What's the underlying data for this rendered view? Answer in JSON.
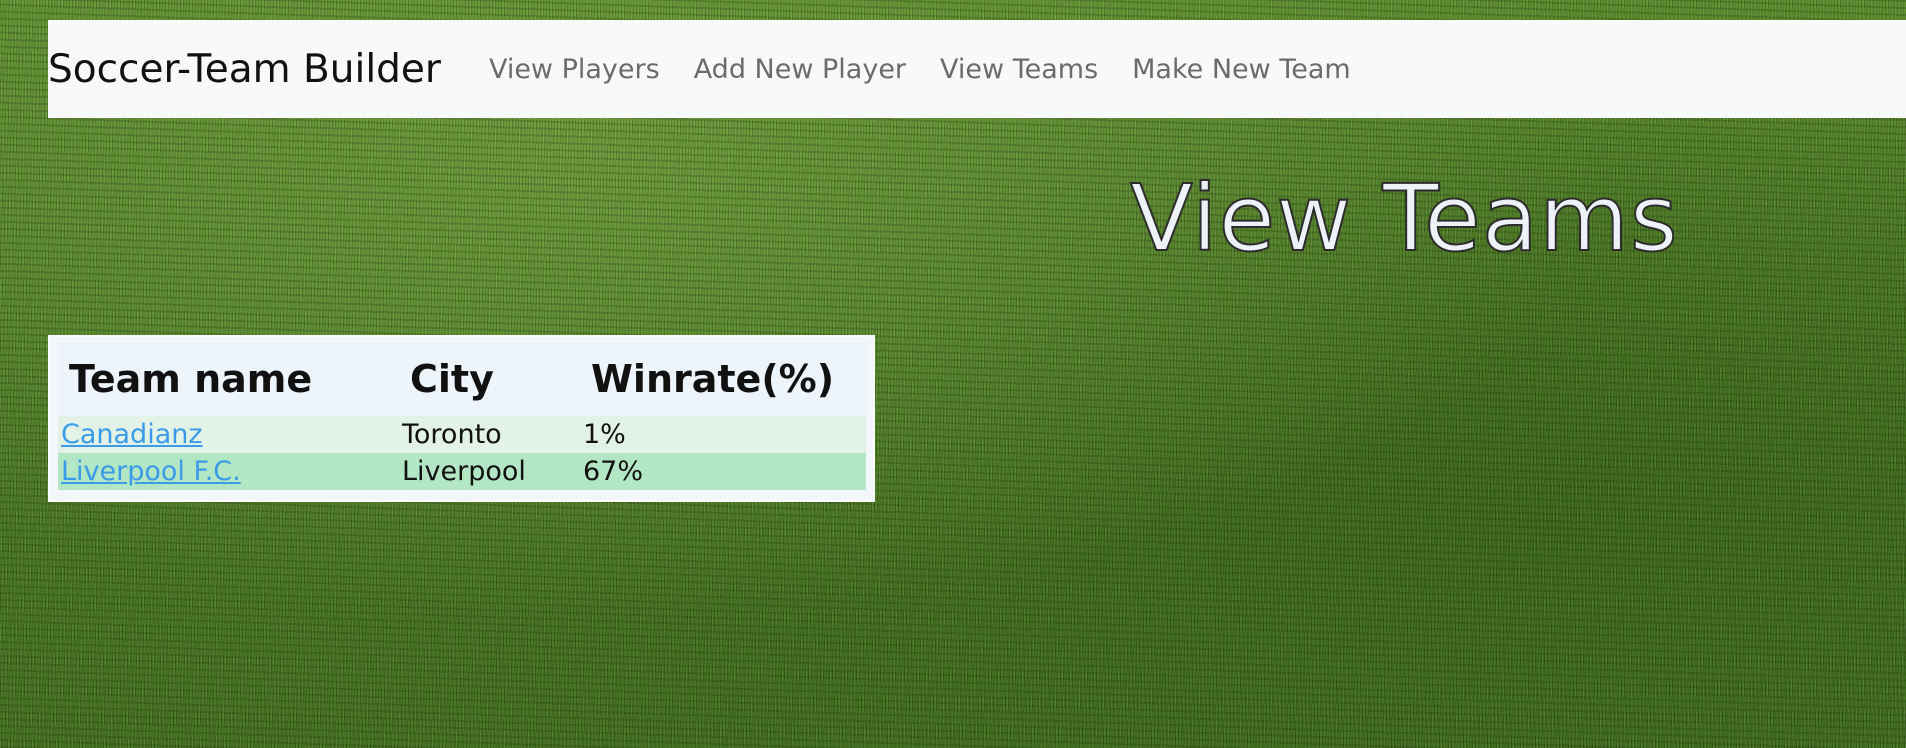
{
  "navbar": {
    "brand": "Soccer-Team Builder",
    "links": [
      {
        "label": "View Players"
      },
      {
        "label": "Add New Player"
      },
      {
        "label": "View Teams"
      },
      {
        "label": "Make New Team"
      }
    ]
  },
  "page": {
    "heading": "View Teams"
  },
  "teams_table": {
    "headers": [
      "Team name",
      "City",
      "Winrate(%)"
    ],
    "rows": [
      {
        "name": "Canadianz",
        "city": "Toronto",
        "winrate": "1%"
      },
      {
        "name": "Liverpool F.C.",
        "city": "Liverpool",
        "winrate": "67%"
      }
    ]
  },
  "colors": {
    "link": "#3a9be8",
    "row_odd": "#e2f2e6",
    "row_even": "#b3e6c4",
    "navbar_bg": "#f8f9fb"
  }
}
